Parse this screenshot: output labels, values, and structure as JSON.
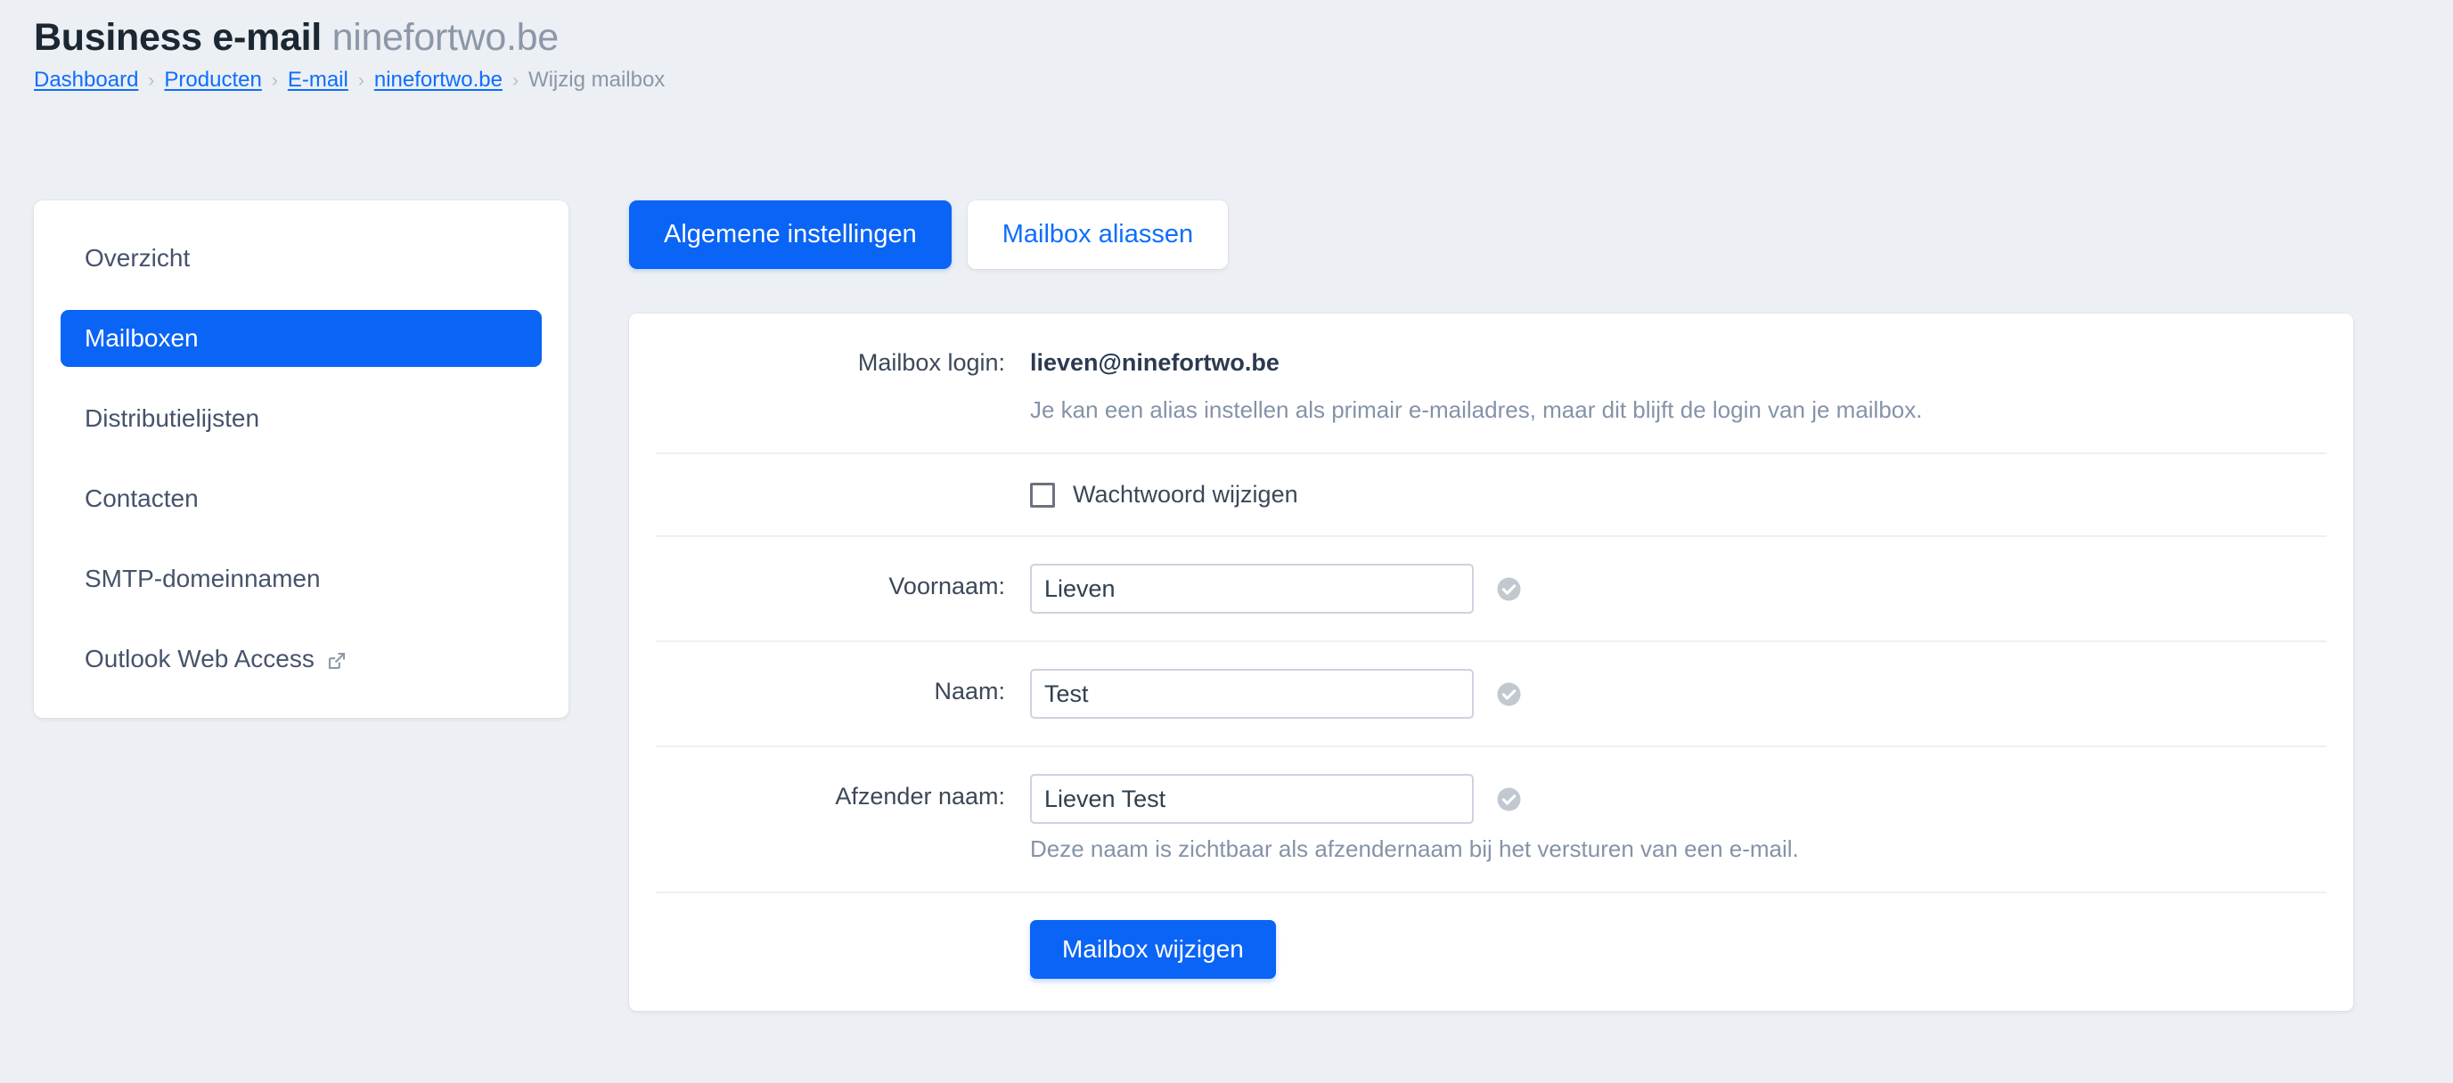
{
  "header": {
    "title_strong": "Business e-mail",
    "title_domain": "ninefortwo.be",
    "breadcrumb": [
      {
        "label": "Dashboard",
        "link": true
      },
      {
        "label": "Producten",
        "link": true
      },
      {
        "label": "E-mail",
        "link": true
      },
      {
        "label": "ninefortwo.be",
        "link": true
      },
      {
        "label": "Wijzig mailbox",
        "link": false
      }
    ],
    "breadcrumb_separator": "›"
  },
  "sidebar": {
    "items": [
      {
        "label": "Overzicht",
        "active": false,
        "external": false
      },
      {
        "label": "Mailboxen",
        "active": true,
        "external": false
      },
      {
        "label": "Distributielijsten",
        "active": false,
        "external": false
      },
      {
        "label": "Contacten",
        "active": false,
        "external": false
      },
      {
        "label": "SMTP-domeinnamen",
        "active": false,
        "external": false
      },
      {
        "label": "Outlook Web Access",
        "active": false,
        "external": true
      }
    ]
  },
  "main": {
    "tabs": [
      {
        "label": "Algemene instellingen",
        "active": true
      },
      {
        "label": "Mailbox aliassen",
        "active": false
      }
    ],
    "form": {
      "mailbox_login": {
        "label": "Mailbox login:",
        "value": "lieven@ninefortwo.be",
        "help": "Je kan een alias instellen als primair e-mailadres, maar dit blijft de login van je mailbox."
      },
      "change_password": {
        "label": "Wachtwoord wijzigen",
        "checked": false
      },
      "first_name": {
        "label": "Voornaam:",
        "value": "Lieven",
        "valid_icon": "check-circle-icon"
      },
      "last_name": {
        "label": "Naam:",
        "value": "Test",
        "valid_icon": "check-circle-icon"
      },
      "sender_name": {
        "label": "Afzender naam:",
        "value": "Lieven Test",
        "valid_icon": "check-circle-icon",
        "help": "Deze naam is zichtbaar als afzendernaam bij het versturen van een e-mail."
      },
      "submit_label": "Mailbox wijzigen"
    }
  },
  "colors": {
    "accent": "#0a64f5",
    "link": "#0d6efd",
    "page_background": "#eceff3",
    "card_background": "#ffffff",
    "muted_text": "#8593a8"
  }
}
